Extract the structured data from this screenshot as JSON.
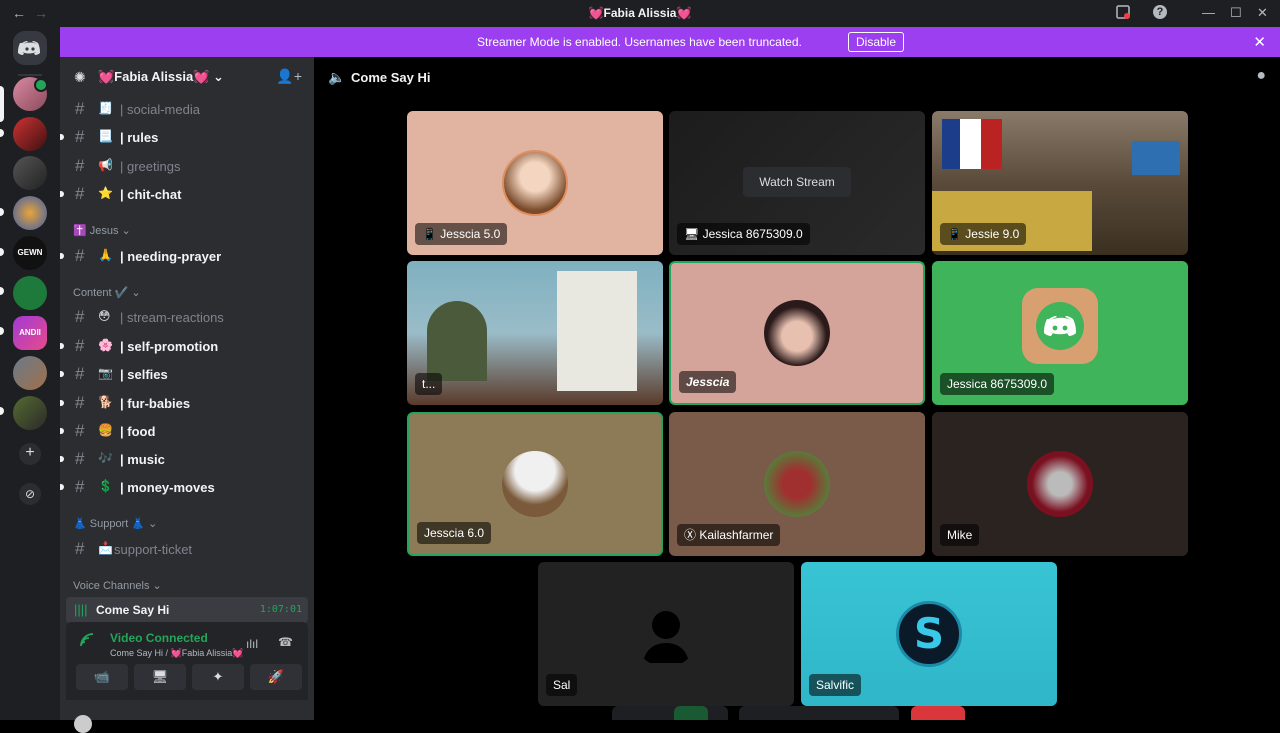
{
  "window": {
    "title": "💓Fabia Alissia💓",
    "back": "←",
    "forward": "→",
    "inbox_icon": "inbox-icon",
    "help": "?",
    "minimize": "—",
    "maximize": "☐",
    "close": "✕"
  },
  "banner": {
    "message": "Streamer Mode is enabled. Usernames have been truncated.",
    "button": "Disable",
    "close": "✕"
  },
  "server": {
    "name": "💓Fabia Alissia💓 ⌄",
    "settings_icon": "✺",
    "invite_icon": "👤+"
  },
  "channels": [
    {
      "emoji": "🧾",
      "label": "| social-media",
      "state": "read"
    },
    {
      "emoji": "📃",
      "label": "| rules",
      "state": "unread"
    },
    {
      "emoji": "📢",
      "label": "| greetings",
      "state": "read"
    },
    {
      "emoji": "⭐",
      "label": "| chit-chat",
      "state": "unread"
    },
    {
      "emoji": "🙏",
      "label": "| needing-prayer",
      "state": "unread"
    },
    {
      "emoji": "😳",
      "label": "| stream-reactions",
      "state": "read"
    },
    {
      "emoji": "🌸",
      "label": "| self-promotion",
      "state": "unread"
    },
    {
      "emoji": "📷",
      "label": "| selfies",
      "state": "unread"
    },
    {
      "emoji": "🐕",
      "label": "| fur-babies",
      "state": "unread"
    },
    {
      "emoji": "🍔",
      "label": "| food",
      "state": "unread"
    },
    {
      "emoji": "🎶",
      "label": "| music",
      "state": "unread"
    },
    {
      "emoji": "💲",
      "label": "| money-moves",
      "state": "unread"
    },
    {
      "emoji": "📩",
      "label": "support-ticket",
      "state": "read"
    }
  ],
  "categories": {
    "jesus": "✝️ Jesus ⌄",
    "content": "Content ✔️ ⌄",
    "support": "👗 Support 👗 ⌄",
    "voice": "Voice Channels ⌄"
  },
  "voice_channel": {
    "name": "Come Say Hi",
    "time": "1:07:01"
  },
  "voice_panel": {
    "status": "Video Connected",
    "sub": "Come Say Hi / 💓Fabia Alissia💓",
    "buttons": [
      "📹",
      "🖥",
      "✦",
      "🚀"
    ]
  },
  "main": {
    "title": "Come Say Hi"
  },
  "tiles": [
    {
      "name": "Jesscia 5.0",
      "device": "📱"
    },
    {
      "name": "Jessica 8675309.0",
      "device": "🖥",
      "watch": "Watch Stream"
    },
    {
      "name": "Jessie 9.0",
      "device": "📱"
    },
    {
      "name": "t..."
    },
    {
      "name": "Jesscia"
    },
    {
      "name": "Jessica 8675309.0"
    },
    {
      "name": "Jesscia 6.0"
    },
    {
      "name": "Kailashfarmer",
      "device": "Ⓧ"
    },
    {
      "name": "Mike"
    },
    {
      "name": "Sal"
    },
    {
      "name": "Salvific"
    }
  ],
  "colors": {
    "accent_green": "#23a55a",
    "banner": "#9b3ff0",
    "discord_blurple": "#5865f2"
  }
}
